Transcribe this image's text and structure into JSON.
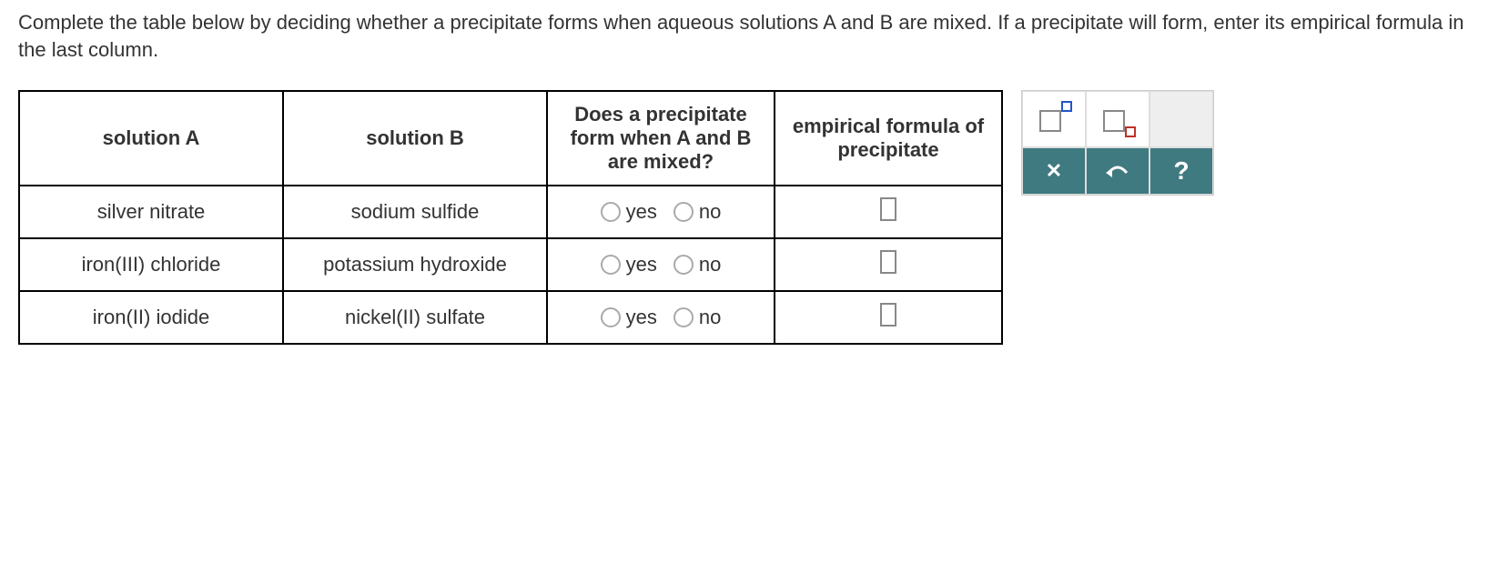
{
  "question": "Complete the table below by deciding whether a precipitate forms when aqueous solutions A and B are mixed. If a precipitate will form, enter its empirical formula in the last column.",
  "headers": {
    "a": "solution A",
    "b": "solution B",
    "c": "Does a precipitate form when A and B are mixed?",
    "d": "empirical formula of precipitate"
  },
  "yes": "yes",
  "no": "no",
  "rows": [
    {
      "a": "silver nitrate",
      "b": "sodium sulfide"
    },
    {
      "a": "iron(III) chloride",
      "b": "potassium hydroxide"
    },
    {
      "a": "iron(II) iodide",
      "b": "nickel(II) sulfate"
    }
  ],
  "toolbox": {
    "superscript": "superscript",
    "subscript": "subscript",
    "clear": "clear",
    "undo": "undo",
    "help": "help"
  }
}
